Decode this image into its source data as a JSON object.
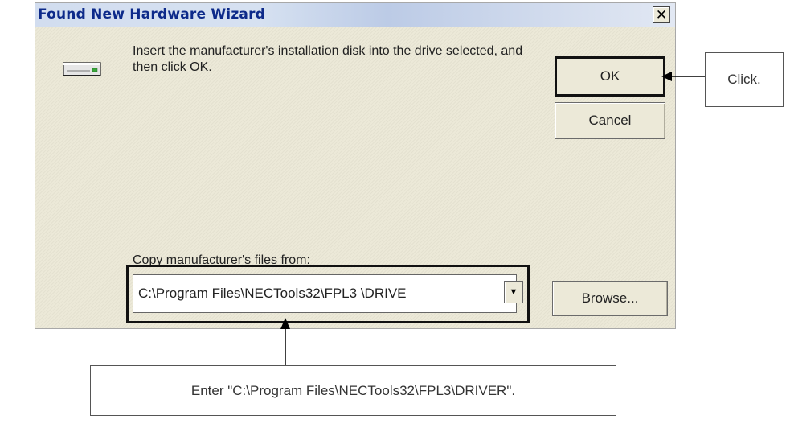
{
  "dialog": {
    "title": "Found New Hardware Wizard",
    "close_glyph": "✕",
    "message": "Insert the manufacturer's installation disk into the drive selected, and then click OK.",
    "ok_label": "OK",
    "cancel_label": "Cancel",
    "copy_label": "Copy manufacturer's files from:",
    "path_value": "C:\\Program Files\\NECTools32\\FPL3 \\DRIVE",
    "dropdown_glyph": "▼",
    "browse_label": "Browse..."
  },
  "annotations": {
    "click": "Click.",
    "enter": "Enter \"C:\\Program Files\\NECTools32\\FPL3\\DRIVER\"."
  },
  "icons": [
    "close-icon",
    "disk-drive-icon",
    "chevron-down-icon",
    "arrow-icon"
  ]
}
